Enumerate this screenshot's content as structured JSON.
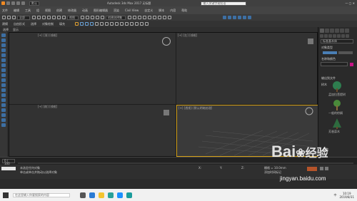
{
  "app": {
    "title": "Autodesk 3ds Max 2017 无标题",
    "workspace": "默认",
    "search_placeholder": "输入关键字或短语"
  },
  "menu": {
    "items": [
      "文件",
      "编辑",
      "工具",
      "组",
      "视图",
      "创建",
      "修改器",
      "动画",
      "图形编辑器",
      "渲染",
      "Civil View",
      "自定义",
      "脚本",
      "内容",
      "帮助"
    ],
    "selection_set": "全部",
    "view": "视图",
    "create_set": "创建选择集"
  },
  "toolbar3": {
    "items": [
      "建模",
      "自由形式",
      "选择",
      "对象绘制",
      "填充"
    ]
  },
  "scene": {
    "tabs": [
      "选择",
      "显示"
    ],
    "root_label": "场景资源管理器"
  },
  "viewports": [
    {
      "label": "[+] [顶] [线框]"
    },
    {
      "label": "[+] [前] [线框]"
    },
    {
      "label": "[+] [左] [线框]"
    },
    {
      "label": "[+] [透视] [默认明暗处理]"
    }
  ],
  "rightpanel": {
    "category": "标准基本体",
    "section1": "对象类型",
    "section2": "名称和颜色",
    "name": "",
    "color": "#c71585",
    "section3": "输出到文件",
    "section4": "树木",
    "section5": "参数",
    "trees": [
      "孟加拉菩提树",
      "一般的棕榈",
      "芳香蒜木"
    ]
  },
  "timeline": {
    "frame_counter": "0 / 100"
  },
  "status": {
    "text1": "未选定任何对象",
    "text2": "单击或单击并拖动以选择对象",
    "x_label": "X:",
    "y_label": "Y:",
    "z_label": "Z:",
    "grid": "栅格 = 10.0mm",
    "add_key": "添加时间标记"
  },
  "taskbar": {
    "search_placeholder": "在这里输入你要搜索的内容",
    "time": "10:19",
    "date": "2019/8/31",
    "lang": "中"
  },
  "watermark": {
    "text1": "Bai",
    "text2": "经验",
    "url": "jingyan.baidu.com"
  }
}
